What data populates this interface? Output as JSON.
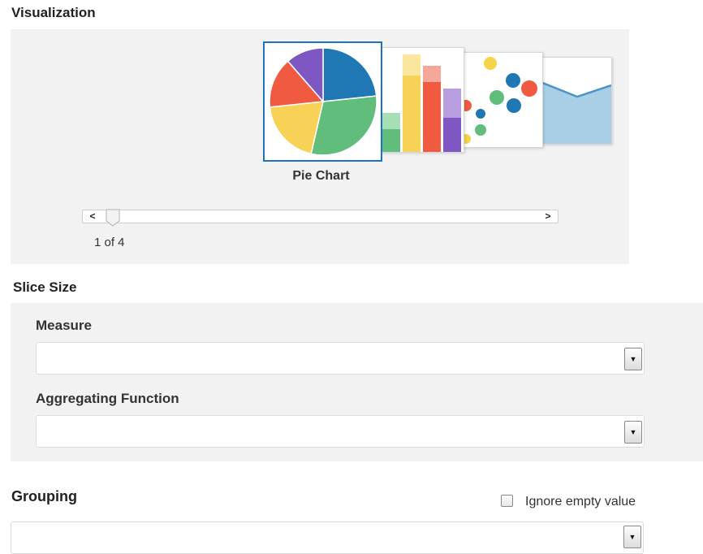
{
  "visualization": {
    "title": "Visualization",
    "selected_label": "Pie Chart",
    "options": [
      "pie-chart",
      "bar-chart",
      "scatter-chart",
      "area-chart"
    ],
    "scroll_left_glyph": "<",
    "scroll_right_glyph": ">",
    "page_indicator": "1 of 4",
    "current_index": 1,
    "total": 4,
    "accent_color": "#1e73be"
  },
  "slice_size": {
    "title": "Slice Size",
    "measure_label": "Measure",
    "measure_value": "",
    "aggregating_function_label": "Aggregating Function",
    "aggregating_function_value": ""
  },
  "grouping": {
    "title": "Grouping",
    "ignore_empty_label": "Ignore empty value",
    "ignore_empty_checked": false,
    "value": ""
  },
  "dropdown_glyph": "▼"
}
